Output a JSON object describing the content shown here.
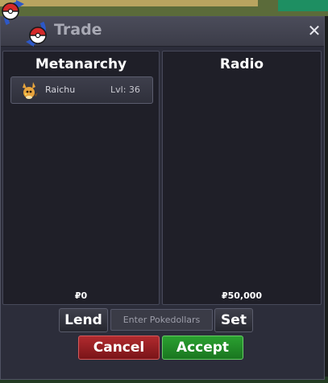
{
  "window": {
    "title": "Trade",
    "close_glyph": "✕",
    "logo_icon": "pokeball-swap-icon"
  },
  "left_panel": {
    "player_name": "Metanarchy",
    "money": "₽0",
    "pokemon": [
      {
        "name": "Raichu",
        "level": "Lvl: 36",
        "icon": "raichu-sprite-icon"
      }
    ]
  },
  "right_panel": {
    "player_name": "Radio",
    "money": "₽50,000",
    "pokemon": []
  },
  "controls": {
    "lend_label": "Lend",
    "amount_placeholder": "Enter Pokedollars",
    "amount_value": "",
    "set_label": "Set",
    "cancel_label": "Cancel",
    "accept_label": "Accept"
  },
  "colors": {
    "cancel": "#9e2226",
    "accept": "#238a28",
    "panel_bg": "#1f1f28",
    "window_bg": "#2c2d3a"
  }
}
